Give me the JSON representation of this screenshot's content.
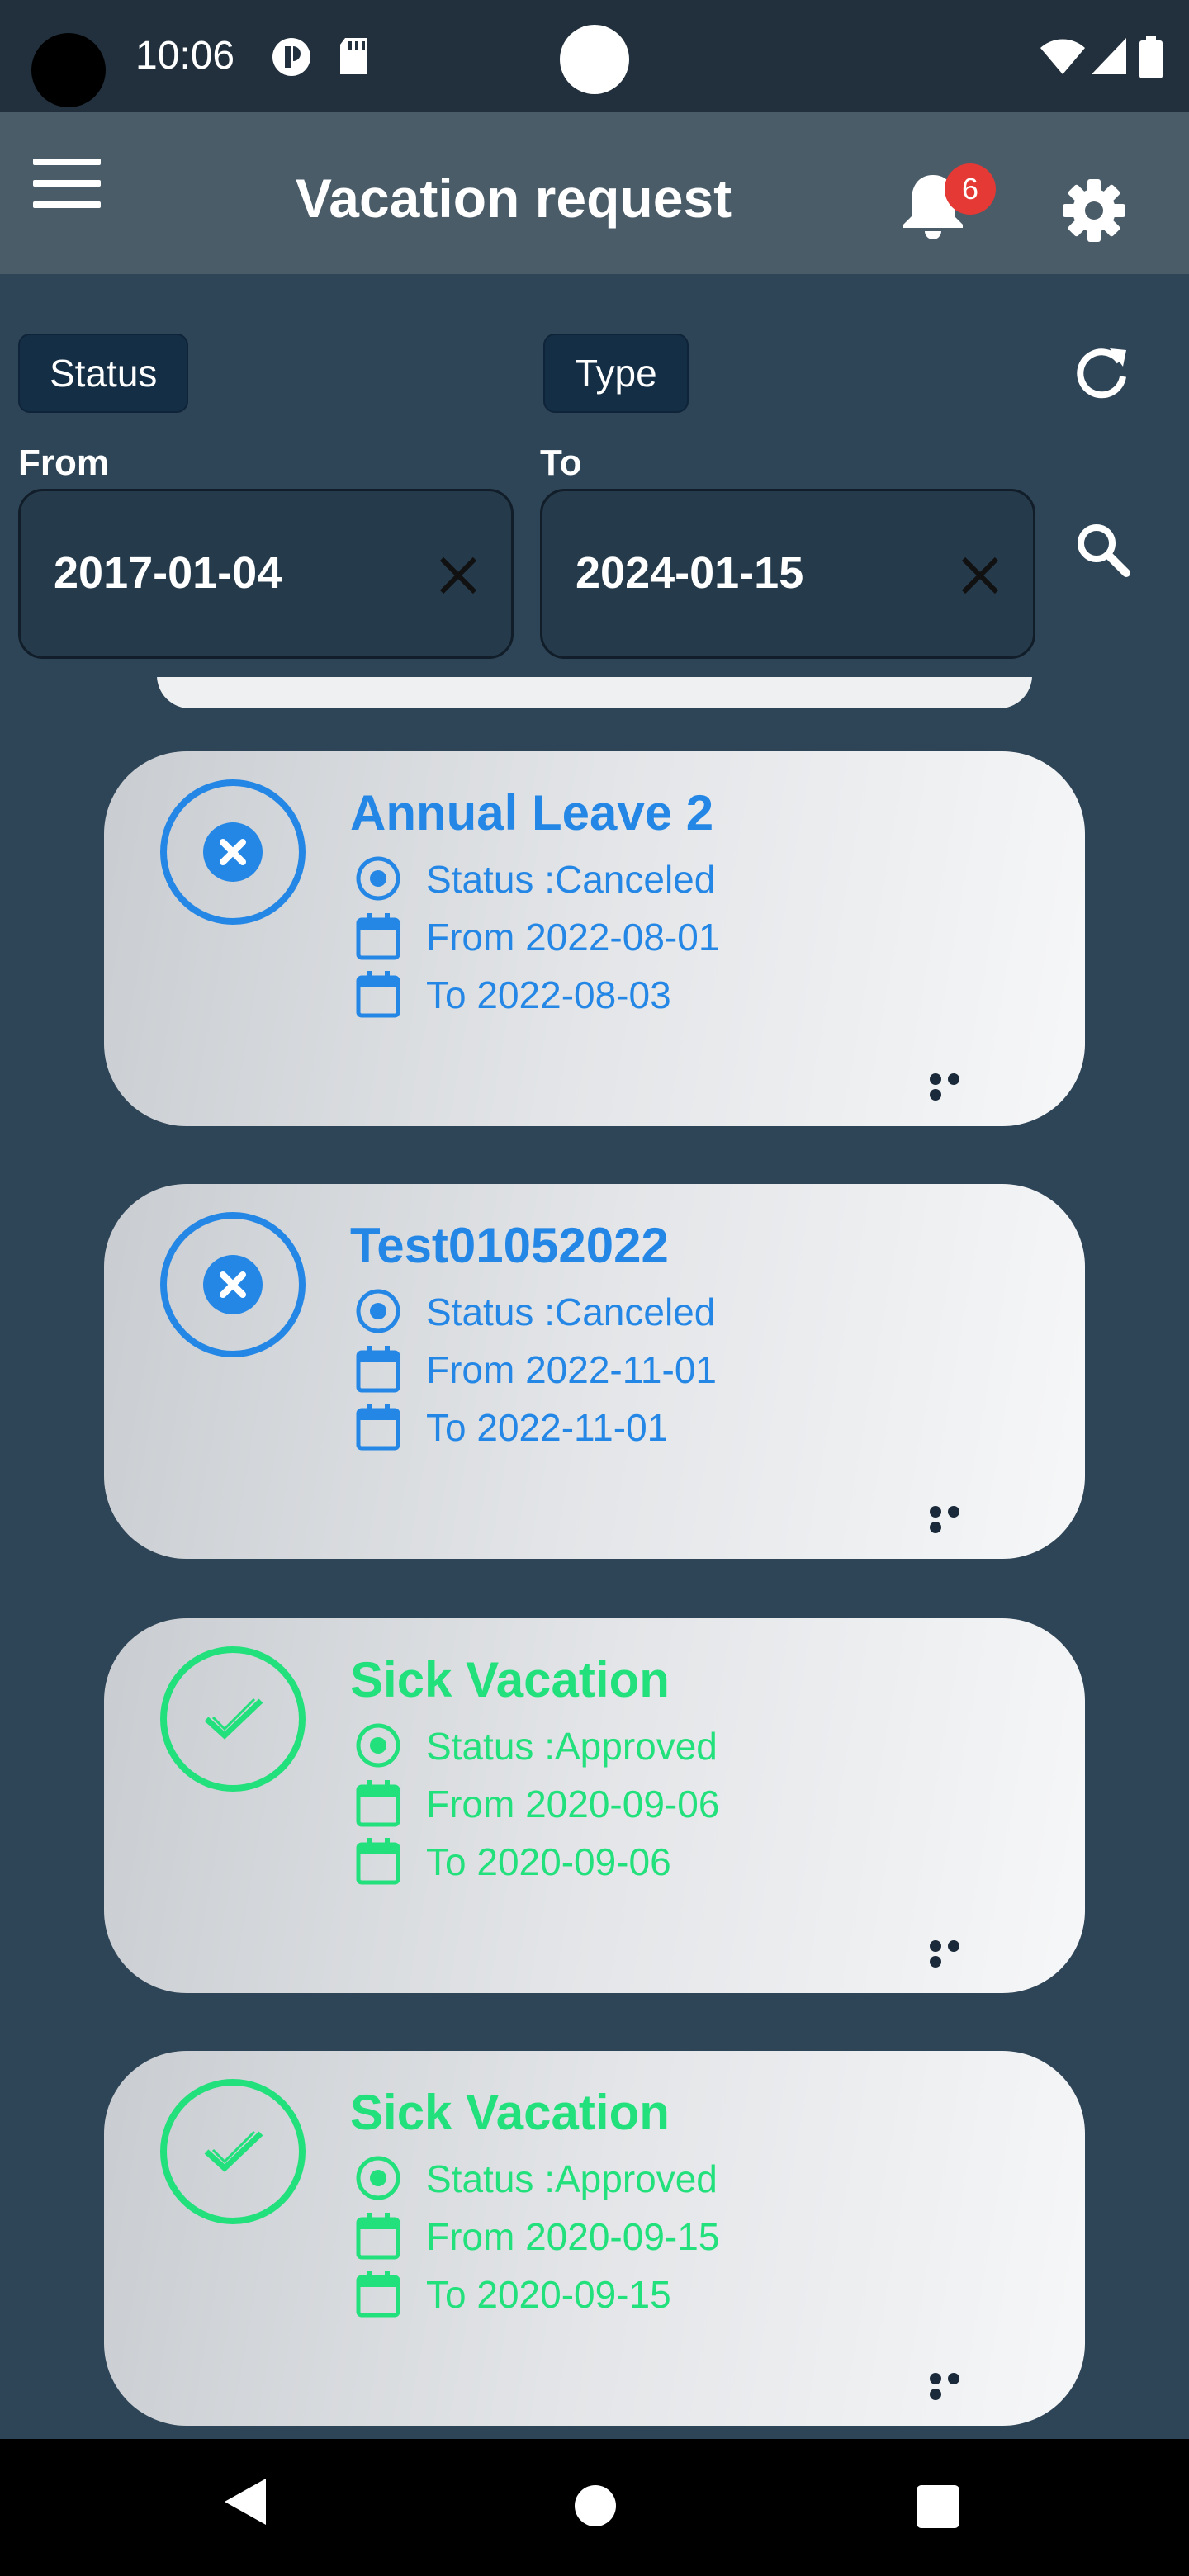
{
  "status_bar": {
    "time": "10:06"
  },
  "app_bar": {
    "title": "Vacation request",
    "notification_count": "6"
  },
  "filters": {
    "status_label": "Status",
    "type_label": "Type",
    "from_label": "From",
    "to_label": "To",
    "from_value": "2017-01-04",
    "to_value": "2024-01-15"
  },
  "colors": {
    "canceled": "#2487e6",
    "approved": "#22e07b",
    "background": "#2e4457"
  },
  "requests": [
    {
      "title": "Annual Leave 2",
      "status": "Status :Canceled",
      "from": "From 2022-08-01",
      "to": "To 2022-08-03",
      "icon": "cancel-icon",
      "color": "blue"
    },
    {
      "title": "Test01052022",
      "status": "Status :Canceled",
      "from": "From 2022-11-01",
      "to": "To 2022-11-01",
      "icon": "cancel-icon",
      "color": "blue"
    },
    {
      "title": "Sick Vacation",
      "status": "Status :Approved",
      "from": "From 2020-09-06",
      "to": "To 2020-09-06",
      "icon": "check-icon",
      "color": "green"
    },
    {
      "title": "Sick Vacation",
      "status": "Status :Approved",
      "from": "From 2020-09-15",
      "to": "To 2020-09-15",
      "icon": "check-icon",
      "color": "green"
    }
  ]
}
